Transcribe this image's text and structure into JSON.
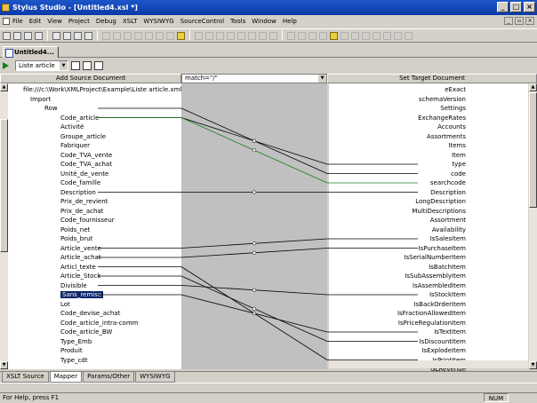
{
  "window": {
    "title": "Stylus Studio - [Untitled4.xsl *]"
  },
  "menu": [
    "File",
    "Edit",
    "View",
    "Project",
    "Debug",
    "XSLT",
    "WYSIWYG",
    "SourceControl",
    "Tools",
    "Window",
    "Help"
  ],
  "doc_tab": "Untitled4...",
  "mapper": {
    "template_combo": "Liste article",
    "source_header": "Add Source Document",
    "match_value": "match=\"/\"",
    "target_header": "Set Target Document",
    "source_root": "file:///c:\\Work\\XMLProject\\Example\\Liste article.xml",
    "source_items": [
      {
        "label": "Import",
        "level": 1
      },
      {
        "label": "Row",
        "level": 2
      },
      {
        "label": "Code_article",
        "level": 3
      },
      {
        "label": "Activité",
        "level": 3
      },
      {
        "label": "Groupe_article",
        "level": 3
      },
      {
        "label": "Fabriquer",
        "level": 3
      },
      {
        "label": "Code_TVA_vente",
        "level": 3
      },
      {
        "label": "Code_TVA_achat",
        "level": 3
      },
      {
        "label": "Unité_de_vente",
        "level": 3
      },
      {
        "label": "Code_famille",
        "level": 3
      },
      {
        "label": "Description",
        "level": 3
      },
      {
        "label": "Prix_de_revient",
        "level": 3
      },
      {
        "label": "Prix_de_achat",
        "level": 3
      },
      {
        "label": "Code_fournisseur",
        "level": 3
      },
      {
        "label": "Poids_net",
        "level": 3
      },
      {
        "label": "Poids_brut",
        "level": 3
      },
      {
        "label": "Article_vente",
        "level": 3
      },
      {
        "label": "Article_achat",
        "level": 3
      },
      {
        "label": "Articl_texte",
        "level": 3
      },
      {
        "label": "Article_Stock",
        "level": 3
      },
      {
        "label": "Divisible",
        "level": 3
      },
      {
        "label": "Sans_remise",
        "level": 3,
        "selected": true
      },
      {
        "label": "Lot",
        "level": 3
      },
      {
        "label": "Code_devise_achat",
        "level": 3
      },
      {
        "label": "Code_article_intra-comm",
        "level": 3
      },
      {
        "label": "Code_article_BW",
        "level": 3
      },
      {
        "label": "Type_Emb",
        "level": 3
      },
      {
        "label": "Produit",
        "level": 3
      },
      {
        "label": "Type_cdt",
        "level": 3
      }
    ],
    "target_items": [
      "eExact",
      "schemaVersion",
      "Settings",
      "ExchangeRates",
      "Accounts",
      "Assortments",
      "Items",
      "Item",
      "type",
      "code",
      "searchcode",
      "Description",
      "LongDescription",
      "MultiDescriptions",
      "Assortment",
      "Availability",
      "IsSalesItem",
      "IsPurchaseItem",
      "IsSerialNumberItem",
      "IsBatchItem",
      "IsSubAssemblyItem",
      "IsAssembledItem",
      "IsStockItem",
      "IsBackOrderItem",
      "IsFractionAllowedItem",
      "IsPriceRegulationItem",
      "IsTextItem",
      "IsDiscountItem",
      "IsExplodeItem",
      "IsPrintItem",
      "GLRevenue"
    ]
  },
  "bottom_tabs": [
    "XSLT Source",
    "Mapper",
    "Params/Other",
    "WYSIWYG"
  ],
  "status": {
    "text": "For Help, press F1",
    "num": "NUM"
  }
}
